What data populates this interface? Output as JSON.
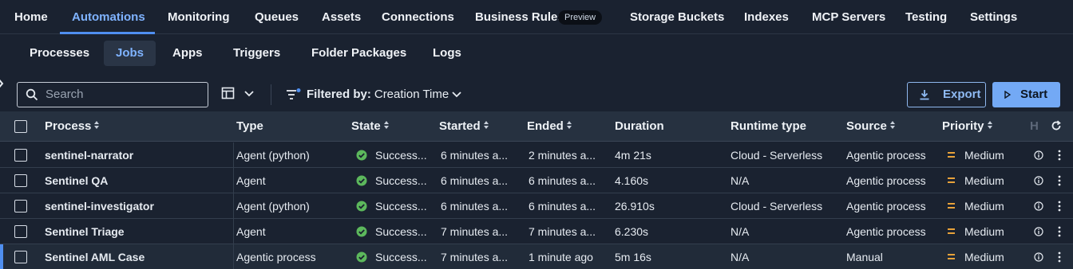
{
  "top_nav": {
    "items": [
      "Home",
      "Automations",
      "Monitoring",
      "Queues",
      "Assets",
      "Connections",
      "Business Rules",
      "Storage Buckets",
      "Indexes",
      "MCP Servers",
      "Testing",
      "Settings"
    ],
    "active": "Automations",
    "preview_badge": "Preview"
  },
  "sub_nav": {
    "items": [
      "Processes",
      "Jobs",
      "Apps",
      "Triggers",
      "Folder Packages",
      "Logs"
    ],
    "active": "Jobs"
  },
  "toolbar": {
    "search_placeholder": "Search",
    "filter_label": "Filtered by:",
    "filter_value": "Creation Time",
    "export_label": "Export",
    "start_label": "Start"
  },
  "table": {
    "headers": [
      "Process",
      "Type",
      "State",
      "Started",
      "Ended",
      "Duration",
      "Runtime type",
      "Source",
      "Priority",
      "H"
    ],
    "rows": [
      {
        "process": "sentinel-narrator",
        "type": "Agent (python)",
        "state": "Success...",
        "started": "6 minutes a...",
        "ended": "2 minutes a...",
        "duration": "4m 21s",
        "runtime": "Cloud - Serverless",
        "source": "Agentic process",
        "priority": "Medium"
      },
      {
        "process": "Sentinel QA",
        "type": "Agent",
        "state": "Success...",
        "started": "6 minutes a...",
        "ended": "6 minutes a...",
        "duration": "4.160s",
        "runtime": "N/A",
        "source": "Agentic process",
        "priority": "Medium"
      },
      {
        "process": "sentinel-investigator",
        "type": "Agent (python)",
        "state": "Success...",
        "started": "6 minutes a...",
        "ended": "6 minutes a...",
        "duration": "26.910s",
        "runtime": "Cloud - Serverless",
        "source": "Agentic process",
        "priority": "Medium"
      },
      {
        "process": "Sentinel Triage",
        "type": "Agent",
        "state": "Success...",
        "started": "7 minutes a...",
        "ended": "7 minutes a...",
        "duration": "6.230s",
        "runtime": "N/A",
        "source": "Agentic process",
        "priority": "Medium"
      },
      {
        "process": "Sentinel AML Case",
        "type": "Agentic process",
        "state": "Success...",
        "started": "7 minutes a...",
        "ended": "1 minute ago",
        "duration": "5m 16s",
        "runtime": "N/A",
        "source": "Manual",
        "priority": "Medium"
      }
    ]
  },
  "colors": {
    "background": "#1a2230",
    "accent": "#4f8ff0",
    "success": "#5cb85c",
    "priority_medium": "#e8a23a"
  }
}
